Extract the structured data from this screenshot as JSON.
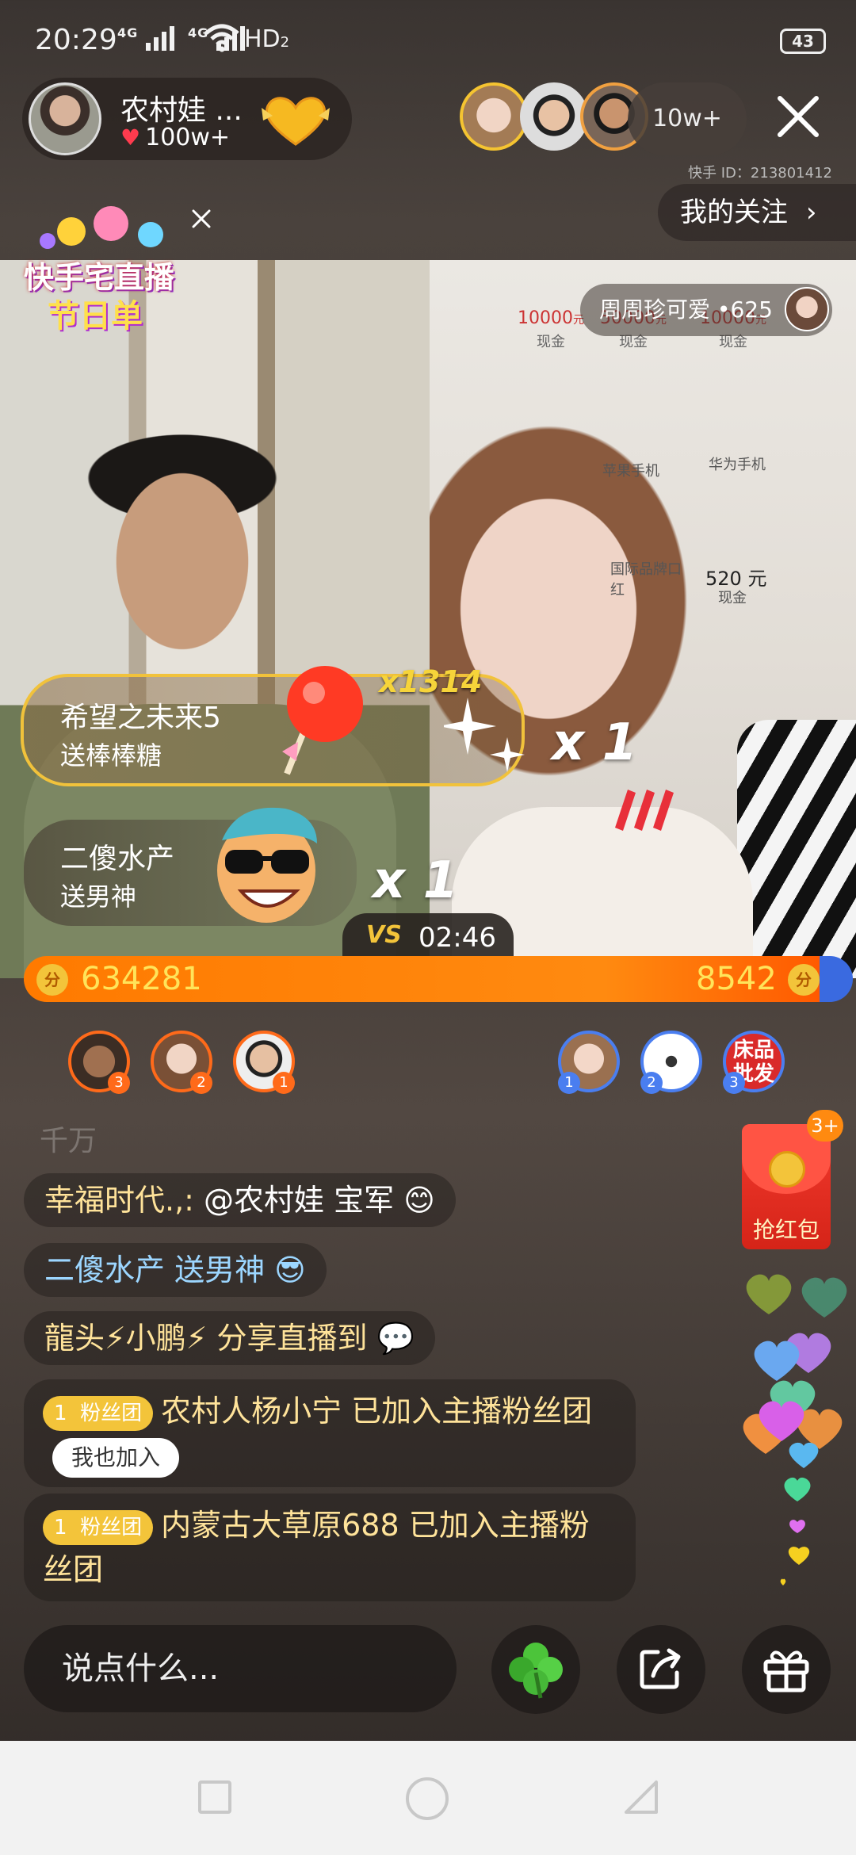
{
  "status_bar": {
    "time": "20:29",
    "network_1": "4G",
    "network_2": "4G",
    "hd": "HD",
    "hd_sub": "2",
    "battery": "43"
  },
  "header": {
    "host_name": "农村娃 ...",
    "host_likes": "100w+",
    "viewer_count": "10w+",
    "kuaishou_id": "快手 ID：213801412",
    "follow_label": "我的关注",
    "follow_chevron": "›"
  },
  "festival_badge": {
    "line1": "快手宅直播",
    "line2": "节日单"
  },
  "video": {
    "opponent_name": "周周珍可爱",
    "opponent_score": "•625",
    "boards": [
      {
        "amount": "10000",
        "unit": "元",
        "label": "现金"
      },
      {
        "amount": "50000",
        "unit": "元",
        "label": "现金"
      },
      {
        "amount": "10000",
        "unit": "元",
        "label": "现金"
      }
    ],
    "board_lines": [
      "苹果手机",
      "华为手机",
      "国际品牌口红",
      "520 元",
      "现金"
    ]
  },
  "gifts": [
    {
      "user": "希望之未来5",
      "action": "送棒棒糖",
      "multiplier": "x1314",
      "multiplier2": "x 1"
    },
    {
      "user": "二傻水产",
      "action": "送男神",
      "multiplier": "x 1"
    }
  ],
  "pk": {
    "vs": "VS",
    "timer": "02:46",
    "left_score": "634281",
    "right_score": "8542",
    "coin_label": "分"
  },
  "ranks": {
    "left": [
      "3",
      "2",
      "1"
    ],
    "right": [
      "1",
      "2",
      "3"
    ],
    "right_badge_text": "床品批发"
  },
  "chat": {
    "faded": "千万",
    "messages": [
      {
        "user": "幸福时代.,:",
        "text": " @农村娃 宝军 😊"
      },
      {
        "user": "二傻水产",
        "text": " 送男神 😎"
      },
      {
        "user": "龍头⚡小鹏⚡",
        "text": " 分享直播到 💬"
      }
    ],
    "fan_joins": [
      {
        "level": "1",
        "badge": "粉丝团",
        "text": "农村人杨小宁 已加入主播粉丝团",
        "join_label": "我也加入"
      },
      {
        "level": "1",
        "badge": "粉丝团",
        "text": "内蒙古大草原688 已加入主播粉丝团"
      }
    ]
  },
  "red_packet": {
    "count": "3+",
    "label": "抢红包"
  },
  "bottom_bar": {
    "placeholder": "说点什么..."
  },
  "colors": {
    "accent_orange": "#ff7a00",
    "gold": "#f3c43a",
    "pk_blue": "#3a6ae0"
  }
}
